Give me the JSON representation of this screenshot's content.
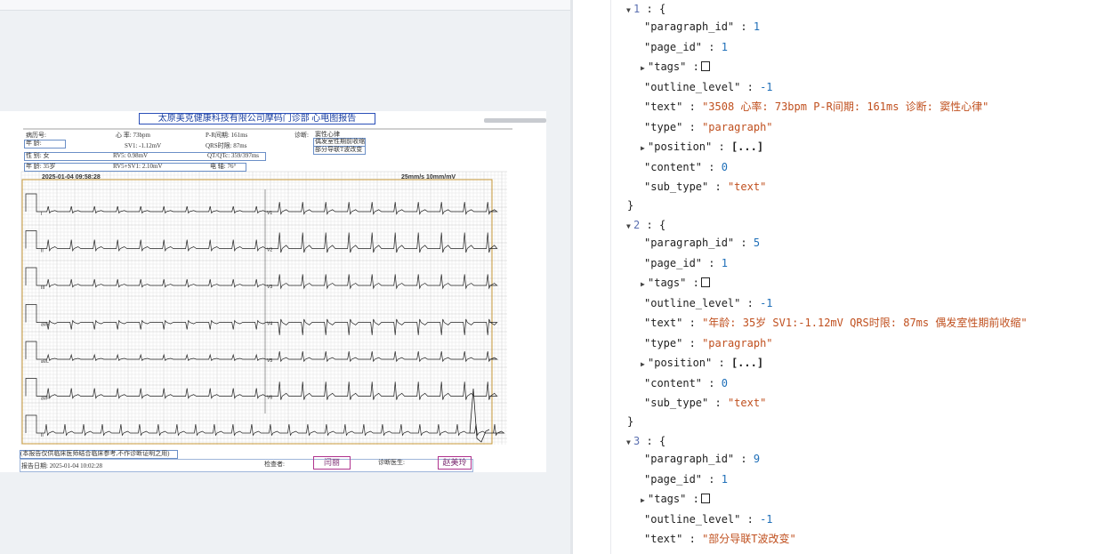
{
  "left_pane": {
    "top_bar_text": "",
    "report": {
      "title": "太原美克健康科技有限公司摩码门诊部 心电图报告",
      "hospital_no_label": "病历号:",
      "heart_rate": "心  率:  73bpm",
      "pr_interval": "P-R间期:  161ms",
      "diagnosis_label": "诊断:",
      "diagnosis_1": "窦性心律",
      "diagnosis_2": "偶发室性期前收缩",
      "diagnosis_3": "部分导联T波改变",
      "age_label": "年  龄:",
      "sv1": "SV1:  -1.12mV",
      "qrs": "QRS时限:  87ms",
      "sex": "性  别:  女",
      "rv5": "RV5:  0.98mV",
      "qt": "QT/QTc:  359/397ms",
      "age": "年  龄:  35岁",
      "rv5sv1": "RV5+SV1:  2.10mV",
      "axis": "电  轴:  76°",
      "timestamp": "2025-01-04 09:58:28",
      "speed": "25mm/s 10mm/mV",
      "leads_left": [
        "I",
        "II",
        "III",
        "aVR",
        "aVL",
        "aVF",
        "II"
      ],
      "leads_right": [
        "V1",
        "V2",
        "V3",
        "V4",
        "V5",
        "V6"
      ],
      "disclaimer": "(本报告仅供临床医师结合临床参考,不作诊断证明之用)",
      "report_date": "报告日期:  2025-01-04 10:02:28",
      "examiner_label": "检查者:",
      "doctor_label": "诊断医生:",
      "examiner_sign": "闫丽",
      "doctor_sign": "赵美玲"
    }
  },
  "json_view": {
    "items": [
      {
        "index": "1",
        "paragraph_id": "1",
        "page_id": "1",
        "outline_level": "-1",
        "text": "\"3508 心率: 73bpm P-R间期: 161ms 诊断: 窦性心律\"",
        "type": "\"paragraph\"",
        "content": "0",
        "sub_type": "\"text\""
      },
      {
        "index": "2",
        "paragraph_id": "5",
        "page_id": "1",
        "outline_level": "-1",
        "text": "\"年龄: 35岁 SV1:-1.12mV QRS时限: 87ms 偶发室性期前收缩\"",
        "type": "\"paragraph\"",
        "content": "0",
        "sub_type": "\"text\""
      },
      {
        "index": "3",
        "paragraph_id": "9",
        "page_id": "1",
        "outline_level": "-1",
        "text": "\"部分导联T波改变\""
      }
    ],
    "keys": {
      "paragraph_id": "\"paragraph_id\"",
      "page_id": "\"page_id\"",
      "tags": "\"tags\"",
      "outline_level": "\"outline_level\"",
      "text": "\"text\"",
      "type": "\"type\"",
      "position": "\"position\"",
      "content": "\"content\"",
      "sub_type": "\"sub_type\""
    },
    "collapsed_array": "[...]",
    "open_brace": "{",
    "close_brace": "}",
    "colon": ":"
  },
  "colors": {
    "string": "#c0501f",
    "number": "#1f6fb8",
    "ecg_grid_minor": "#e4e4e4",
    "ecg_grid_major": "#c9c9c9",
    "ecg_border": "#c99a3a"
  }
}
